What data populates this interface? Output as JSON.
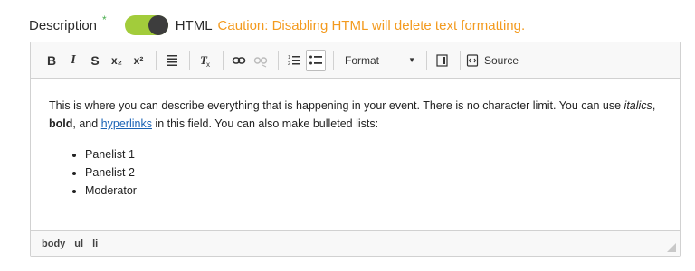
{
  "field": {
    "label": "Description",
    "required_mark": "*",
    "toggle_label": "HTML",
    "caution": "Caution: Disabling HTML will delete text formatting."
  },
  "toolbar": {
    "bold": "B",
    "italic": "I",
    "strike": "S",
    "subscript": "x₂",
    "superscript": "x²",
    "format_label": "Format",
    "source_label": "Source"
  },
  "content": {
    "para_part1": "This is where you can describe everything that is happening in your event. There is no character limit. You can use ",
    "italic_word": "italics",
    "comma": ", ",
    "bold_word": "bold",
    "and": ", and ",
    "link_word": "hyperlinks",
    "para_part2": " in this field. You can also make bulleted lists:",
    "list": [
      "Panelist 1",
      "Panelist 2",
      "Moderator"
    ]
  },
  "statusbar": {
    "path": [
      "body",
      "ul",
      "li"
    ]
  },
  "colors": {
    "toggle_on": "#a2cc3b",
    "caution": "#f39a1e",
    "required": "#4caf50",
    "link": "#1a63b5"
  }
}
